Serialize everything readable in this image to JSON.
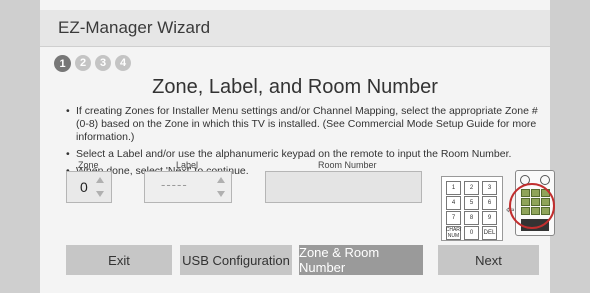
{
  "wizard": {
    "title": "EZ-Manager Wizard"
  },
  "steps": [
    "1",
    "2",
    "3",
    "4"
  ],
  "heading": "Zone, Label, and Room Number",
  "bullets": [
    "If creating Zones for Installer Menu settings and/or Channel Mapping, select the appropriate Zone # (0-8) based on the Zone in which this TV is installed. (See Commercial Mode Setup Guide for more information.)",
    "Select a Label and/or use the alphanumeric keypad on the remote to input the Room Number.",
    "When done, select 'Next' to continue."
  ],
  "zone": {
    "label": "Zone",
    "value": "0"
  },
  "label_field": {
    "label": "Label",
    "value": "-----"
  },
  "room": {
    "label": "Room Number",
    "value": ""
  },
  "keypad": [
    "1",
    "2",
    "3",
    "4",
    "5",
    "6",
    "7",
    "8",
    "9",
    "CHAR/ NUM",
    "0",
    "DEL"
  ],
  "buttons": {
    "exit": "Exit",
    "usb": "USB Configuration",
    "zone_room": "Zone & Room Number",
    "next": "Next"
  },
  "colors": {
    "highlight_circle": "#c12e2e",
    "selected_button": "#9a9a9a"
  }
}
